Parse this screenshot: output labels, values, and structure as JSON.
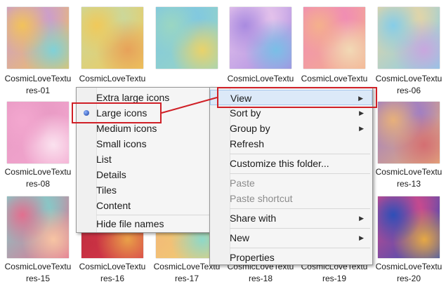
{
  "files": [
    {
      "name_line1": "CosmicLoveTextu",
      "name_line2": "res-01",
      "colors": [
        "#f2c25a",
        "#7fd1d8",
        "#c89ad6"
      ]
    },
    {
      "name_line1": "CosmicLoveTextu",
      "name_line2": "",
      "colors": [
        "#f0c95a",
        "#e7a25a",
        "#c8d9a0"
      ]
    },
    {
      "name_line1": "",
      "name_line2": "",
      "colors": [
        "#9ad6c2",
        "#e9d26a",
        "#7fc7e2"
      ]
    },
    {
      "name_line1": "CosmicLoveTextu",
      "name_line2": "",
      "colors": [
        "#a98be0",
        "#79bfe6",
        "#e9c7ec"
      ]
    },
    {
      "name_line1": "CosmicLoveTextu",
      "name_line2": "",
      "colors": [
        "#f4b08c",
        "#f2d9b5",
        "#f08ab7"
      ]
    },
    {
      "name_line1": "CosmicLoveTextu",
      "name_line2": "res-06",
      "colors": [
        "#86cde8",
        "#c8a7de",
        "#e9d5a2"
      ]
    },
    {
      "name_line1": "CosmicLoveTextu",
      "name_line2": "res-08",
      "colors": [
        "#f3a7cf",
        "#fbe2ef",
        "#e89ac4"
      ]
    },
    {
      "name_line1": "CosmicLoveTextu",
      "name_line2": "res-13",
      "colors": [
        "#e7b07a",
        "#d46f72",
        "#9b7ac8"
      ]
    },
    {
      "name_line1": "CosmicLoveTextu",
      "name_line2": "res-15",
      "colors": [
        "#e26f8f",
        "#f7c4a3",
        "#7fd0cc"
      ]
    },
    {
      "name_line1": "CosmicLoveTextu",
      "name_line2": "res-16",
      "colors": [
        "#d83a4c",
        "#e9a048",
        "#b8283a"
      ]
    },
    {
      "name_line1": "CosmicLoveTextu",
      "name_line2": "res-17",
      "colors": [
        "#f0d070",
        "#8ed8c9",
        "#f3b07c"
      ]
    },
    {
      "name_line1": "CosmicLoveTextu",
      "name_line2": "res-18",
      "colors": [
        "#e96c9a",
        "#f3c2d8",
        "#f5a06f"
      ]
    },
    {
      "name_line1": "CosmicLoveTextu",
      "name_line2": "res-19",
      "colors": [
        "#f4c97a",
        "#e99ab6",
        "#f6ded0"
      ]
    },
    {
      "name_line1": "CosmicLoveTextu",
      "name_line2": "res-20",
      "colors": [
        "#2e4fb8",
        "#e6a844",
        "#d7498a"
      ]
    }
  ],
  "view_submenu": {
    "items": [
      {
        "label": "Extra large icons",
        "selected": false
      },
      {
        "label": "Large icons",
        "selected": true
      },
      {
        "label": "Medium icons",
        "selected": false
      },
      {
        "label": "Small icons",
        "selected": false
      },
      {
        "label": "List",
        "selected": false
      },
      {
        "label": "Details",
        "selected": false
      },
      {
        "label": "Tiles",
        "selected": false
      },
      {
        "label": "Content",
        "selected": false
      }
    ],
    "footer_item": "Hide file names"
  },
  "context_menu": {
    "view": "View",
    "sort_by": "Sort by",
    "group_by": "Group by",
    "refresh": "Refresh",
    "customize": "Customize this folder...",
    "paste": "Paste",
    "paste_shortcut": "Paste shortcut",
    "share_with": "Share with",
    "new": "New",
    "properties": "Properties"
  },
  "colors": {
    "highlight_border": "#d02027",
    "menu_hover": "#dce9f8"
  }
}
